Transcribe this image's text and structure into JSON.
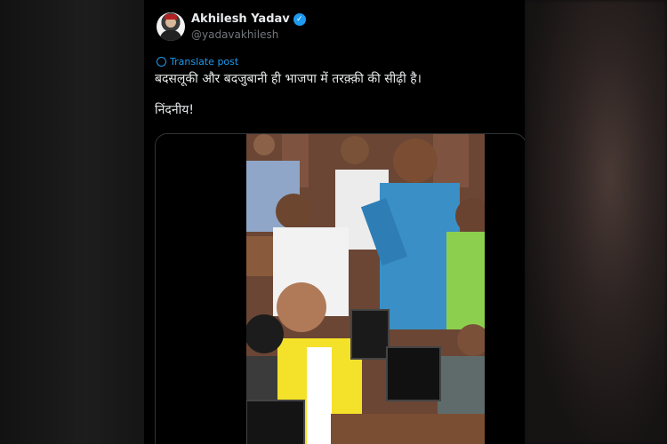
{
  "post": {
    "author_name": "Akhilesh Yadav",
    "handle": "@yadavakhilesh",
    "translate_label": "Translate post",
    "text_line1": "बदसलूकी और बदजुबानी ही भाजपा में तरक़्क़ी की सीढ़ी है।",
    "text_line2": "निंदनीय!"
  },
  "colors": {
    "accent": "#1d9bf0",
    "background": "#000000",
    "text": "#e7e9ea",
    "secondary_text": "#71767b"
  }
}
